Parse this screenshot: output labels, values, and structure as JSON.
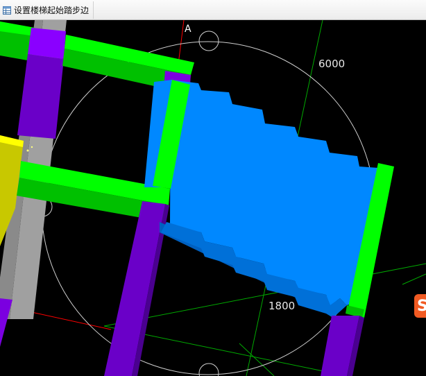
{
  "toolbar": {
    "set_stair_start_label": "设置楼梯起始踏步边"
  },
  "viewport": {
    "axis_label": "A",
    "dim_top": "6000",
    "dim_bottom": "1800"
  },
  "ime": {
    "badge_text": "S"
  },
  "colors": {
    "background": "#000000",
    "beam_green": "#00ff00",
    "beam_green_dark": "#00c000",
    "column_purple": "#7b00e0",
    "column_purple_dark": "#5a00b0",
    "column_gray": "#a0a0a0",
    "slab_blue": "#0088ff",
    "slab_blue_dark": "#0060c0",
    "yellow": "#ffff00",
    "axis_red": "#ff0000",
    "grid_green": "#00aa00"
  },
  "icons": {
    "toolbar_button": "table-icon",
    "ime": "sogou-ime-icon"
  }
}
